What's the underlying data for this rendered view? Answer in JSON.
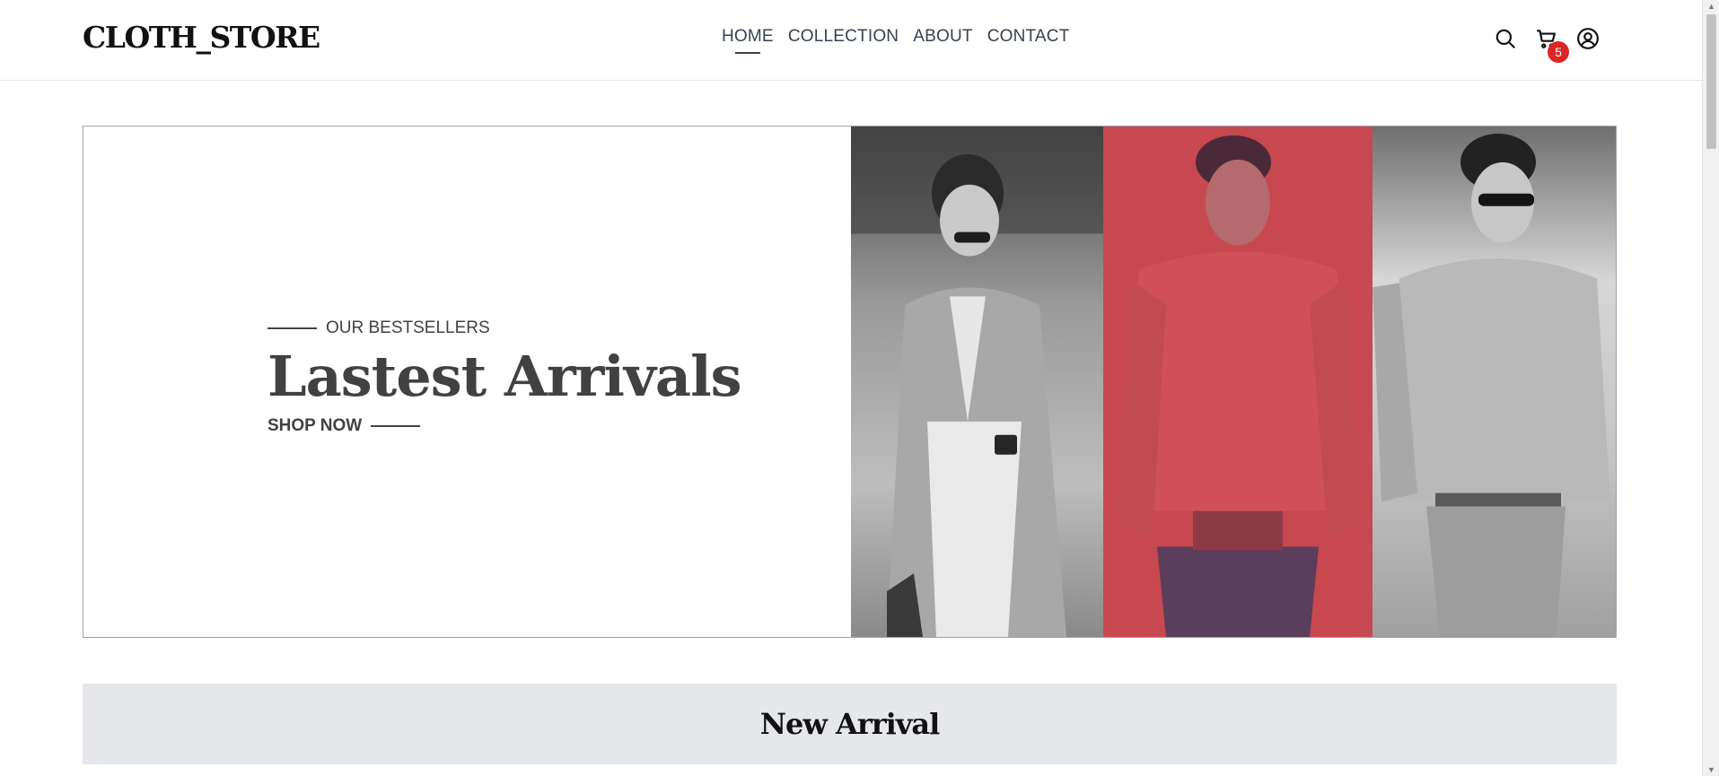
{
  "header": {
    "logo": "CLOTH_STORE",
    "nav": [
      "HOME",
      "COLLECTION",
      "ABOUT",
      "CONTACT"
    ],
    "active_nav": "HOME",
    "cart_count": "5",
    "icons": [
      "search-icon",
      "cart-icon",
      "profile-icon"
    ]
  },
  "hero": {
    "eyebrow": "OUR BESTSELLERS",
    "title": "Lastest Arrivals",
    "cta": "SHOP NOW",
    "colors": {
      "accent_panel": "#c8484f",
      "text": "#414141"
    }
  },
  "section": {
    "title": "New Arrival"
  },
  "colors": {
    "badge": "#dc2626",
    "band": "#e5e7eb"
  }
}
